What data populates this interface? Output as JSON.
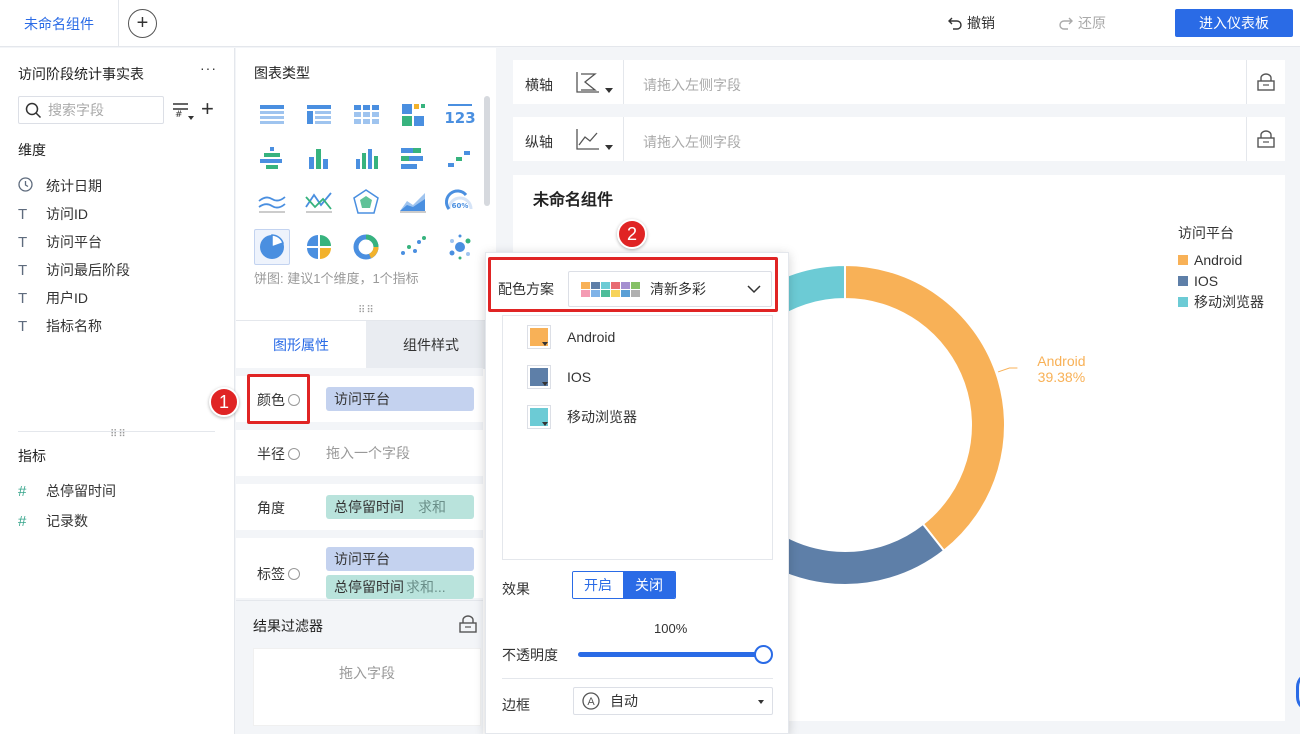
{
  "topbar": {
    "tab_label": "未命名组件",
    "undo_label": "撤销",
    "redo_label": "还原",
    "enter_dashboard_label": "进入仪表板"
  },
  "left": {
    "dataset_title": "访问阶段统计事实表",
    "more_label": "···",
    "search_placeholder": "搜索字段",
    "dimension_title": "维度",
    "dimensions": [
      {
        "label": "统计日期",
        "icon": "clock-icon"
      },
      {
        "label": "访问ID",
        "icon": "text-field-icon"
      },
      {
        "label": "访问平台",
        "icon": "text-field-icon"
      },
      {
        "label": "访问最后阶段",
        "icon": "text-field-icon"
      },
      {
        "label": "用户ID",
        "icon": "text-field-icon"
      },
      {
        "label": "指标名称",
        "icon": "text-field-icon"
      }
    ],
    "metric_title": "指标",
    "metrics": [
      {
        "label": "总停留时间",
        "icon": "number-field-icon"
      },
      {
        "label": "记录数",
        "icon": "number-field-icon"
      }
    ]
  },
  "middle": {
    "chart_type_title": "图表类型",
    "chart_type_hint": "饼图: 建议1个维度，1个指标",
    "chart_type_icons": [
      "table-icon",
      "cross-table-icon",
      "detail-table-icon",
      "color-table-icon",
      "kpi-number-icon",
      "grouped-bar-icon",
      "column-icon",
      "stacked-column-icon",
      "horizontal-bar-icon",
      "scatter-step-icon",
      "line-icon",
      "polyline-icon",
      "radar-icon",
      "area-icon",
      "gauge-icon",
      "pie-icon",
      "multi-pie-icon",
      "donut-icon",
      "scatter-icon",
      "bubble-icon"
    ],
    "gauge_text": "60%",
    "kpi_text": "123",
    "tabs": {
      "props": "图形属性",
      "style": "组件样式"
    },
    "props": {
      "color_label": "颜色",
      "color_field": "访问平台",
      "radius_label": "半径",
      "radius_placeholder": "拖入一个字段",
      "angle_label": "角度",
      "angle_field": "总停留时间",
      "angle_agg": "求和",
      "label_label": "标签",
      "label_field_1": "访问平台",
      "label_field_2": "总停留时间",
      "label_field_2_agg": "求和..."
    },
    "filter_title": "结果过滤器",
    "filter_placeholder": "拖入字段"
  },
  "axes": {
    "x_label": "横轴",
    "y_label": "纵轴",
    "placeholder": "请拖入左侧字段"
  },
  "chart_card": {
    "title": "未命名组件",
    "legend_title": "访问平台"
  },
  "chart_data": {
    "type": "pie",
    "categories": [
      "Android",
      "IOS",
      "移动浏览器"
    ],
    "colors": [
      "#f8b157",
      "#5e7fa8",
      "#6ccbd5"
    ],
    "values": [
      39.38,
      50.62,
      10.0
    ],
    "data_labels": [
      {
        "name": "Android",
        "value": "39.38%"
      }
    ],
    "legend": "top-right"
  },
  "popup": {
    "scheme_label": "配色方案",
    "scheme_name": "清新多彩",
    "scheme_swatches": [
      "#f8b157",
      "#5e7fa8",
      "#6ccbd5",
      "#e86b72",
      "#a58fd0",
      "#86c166",
      "#f49bb3",
      "#7fb3e8",
      "#4dbd9a",
      "#f7d35a",
      "#5a9fd6",
      "#b0b0b0"
    ],
    "colors": [
      {
        "label": "Android",
        "color": "#f8b157"
      },
      {
        "label": "IOS",
        "color": "#5e7fa8"
      },
      {
        "label": "移动浏览器",
        "color": "#6ccbd5"
      }
    ],
    "effect_label": "效果",
    "effect_on": "开启",
    "effect_off": "关闭",
    "opacity_label": "不透明度",
    "opacity_value": "100%",
    "opacity_level": 1.0,
    "border_label": "边框",
    "border_icon_text": "A",
    "border_value": "自动"
  },
  "annotations": {
    "badge_1": "1",
    "badge_2": "2",
    "accent": "#e02424"
  },
  "colors": {
    "primary": "#2a6be6"
  }
}
